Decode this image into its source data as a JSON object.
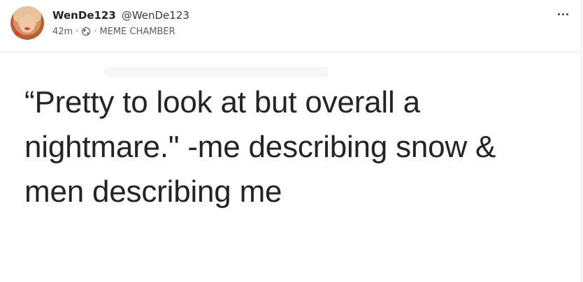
{
  "post": {
    "author": {
      "display_name": "WenDe123",
      "handle": "@WenDe123"
    },
    "meta": {
      "time": "42m",
      "separator": "·",
      "visibility_icon": "globe-icon",
      "group": "MEME CHAMBER"
    },
    "more_icon": "more-horizontal-icon",
    "text_lines": [
      "“Pretty to look at but overall a",
      "nightmare.\" -me describing snow &",
      "men describing me"
    ]
  },
  "colors": {
    "text": "#242424",
    "meta": "#5d5d5d",
    "divider": "#e9e9ea",
    "background": "#ffffff"
  }
}
